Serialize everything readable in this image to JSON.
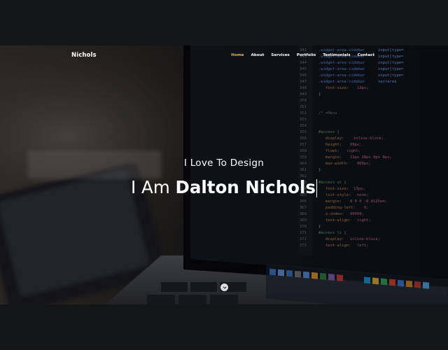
{
  "brand": "Nichols",
  "nav": {
    "items": [
      "Home",
      "About",
      "Services",
      "Portfolio",
      "Testimonials",
      "Contact"
    ],
    "active_index": 0
  },
  "hero": {
    "tagline": "I Love To Design",
    "headline_prefix": "I Am",
    "headline_name": "Dalton Nichols"
  },
  "colors": {
    "page_background": "#141516",
    "nav_active": "#e5b46b",
    "text": "#ffffff"
  },
  "icons": {
    "scroll_down": "chevron-down-icon"
  }
}
